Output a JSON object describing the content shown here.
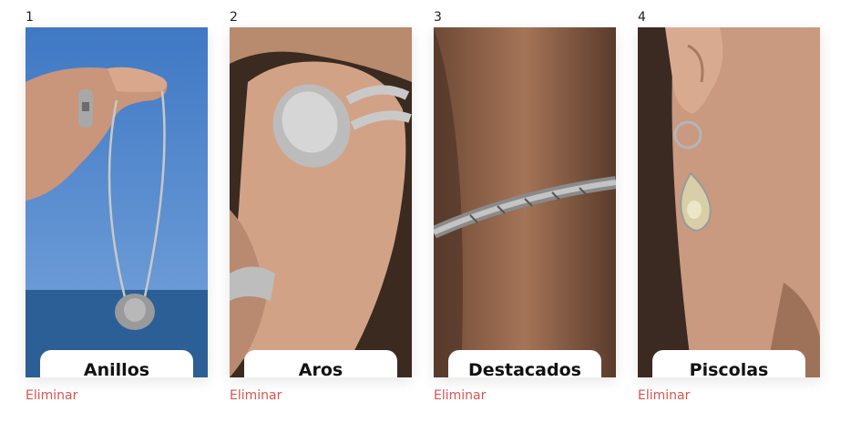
{
  "cards": [
    {
      "number": "1",
      "category": "Anillos",
      "remove_label": "Eliminar",
      "image_subject": "silver-ring-and-pendant-necklace"
    },
    {
      "number": "2",
      "category": "Aros",
      "remove_label": "Eliminar",
      "image_subject": "large-silver-rings-on-hand"
    },
    {
      "number": "3",
      "category": "Destacados",
      "remove_label": "Eliminar",
      "image_subject": "engraved-silver-bangle"
    },
    {
      "number": "4",
      "category": "Piscolas",
      "remove_label": "Eliminar",
      "image_subject": "hoop-earring-with-crystal-drop"
    }
  ],
  "colors": {
    "remove_link": "#d9534f",
    "button_bg": "#ffffff",
    "button_text": "#111111"
  }
}
